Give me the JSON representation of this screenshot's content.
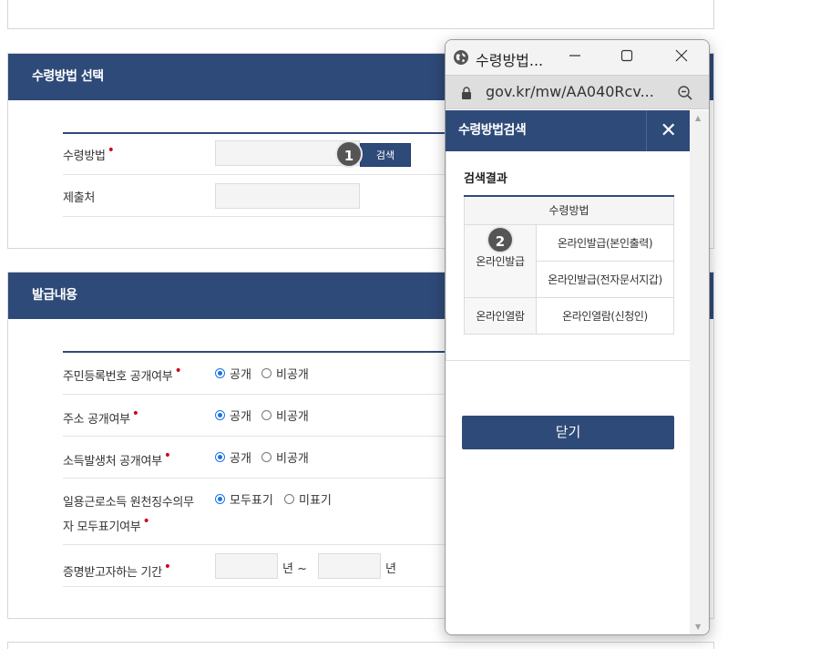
{
  "section1": {
    "title": "수령방법 선택",
    "rows": [
      {
        "label": "수령방법",
        "required": "•"
      },
      {
        "label": "제출처",
        "required": ""
      }
    ],
    "search_label": "검색"
  },
  "section2": {
    "title": "발급내용",
    "rows": [
      {
        "label": "주민등록번호 공개여부",
        "required": "•",
        "opt1": "공개",
        "opt2": "비공개"
      },
      {
        "label": "주소 공개여부",
        "required": "•",
        "opt1": "공개",
        "opt2": "비공개"
      },
      {
        "label": "소득발생처 공개여부",
        "required": "•",
        "opt1": "공개",
        "opt2": "비공개"
      },
      {
        "label_line1": "일용근로소득 원천징수의무",
        "label_line2": "자 모두표기여부",
        "required": "•",
        "opt1": "모두표기",
        "opt2": "미표기"
      },
      {
        "label": "증명받고자하는 기간",
        "required": "•",
        "unit1": "년 ~",
        "unit2": "년"
      }
    ]
  },
  "badges": {
    "one": "1",
    "two": "2"
  },
  "popup": {
    "window_title": "수령방법...",
    "url": "gov.kr/mw/AA040Rcv...",
    "modal_title": "수령방법검색",
    "close_icon_glyph": "✕",
    "result_title": "검색결과",
    "table": {
      "header": "수령방법",
      "groups": [
        {
          "group": "온라인발급",
          "items": [
            "온라인발급(본인출력)",
            "온라인발급(전자문서지갑)"
          ]
        },
        {
          "group": "온라인열람",
          "items": [
            "온라인열람(신청인)"
          ]
        }
      ]
    },
    "close_button": "닫기"
  },
  "colors": {
    "primary": "#2e4a78",
    "required": "#d0021b",
    "radio": "#1a73e8"
  }
}
